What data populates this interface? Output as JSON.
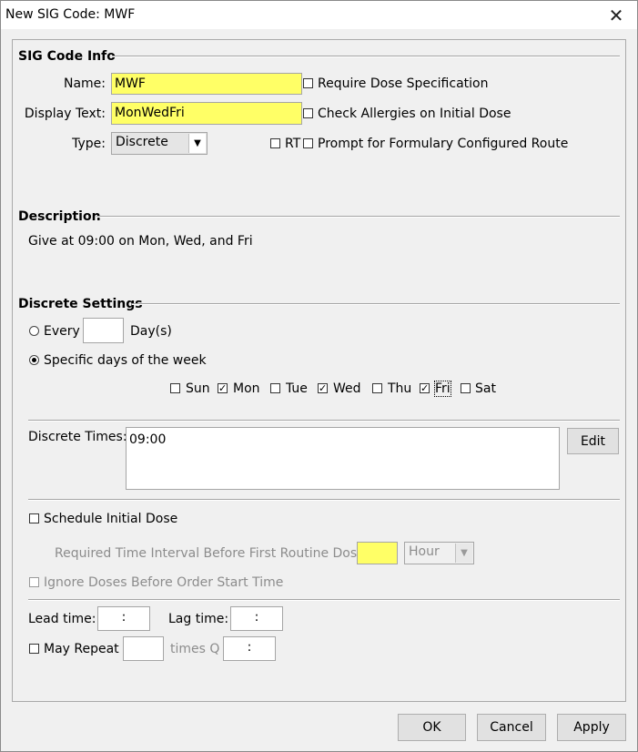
{
  "window": {
    "title": "New SIG Code: MWF",
    "close_glyph": "✕"
  },
  "sig_info": {
    "section_title": "SIG Code Info",
    "name_label": "Name:",
    "name_value": "MWF",
    "display_label": "Display Text:",
    "display_value": "MonWedFri",
    "type_label": "Type:",
    "type_value": "Discrete",
    "require_dose_label": "Require Dose Specification",
    "require_dose_checked": false,
    "check_allergies_label": "Check Allergies on Initial Dose",
    "check_allergies_checked": false,
    "rt_label": "RT",
    "rt_checked": false,
    "prompt_route_label": "Prompt for Formulary Configured Route",
    "prompt_route_checked": false
  },
  "description": {
    "section_title": "Description",
    "text": "Give at 09:00 on Mon, Wed, and Fri"
  },
  "discrete": {
    "section_title": "Discrete Settings",
    "every_label": "Every",
    "every_value": "",
    "days_label": "Day(s)",
    "specific_label": "Specific days of the week",
    "selected_mode": "specific",
    "days": [
      {
        "label": "Sun",
        "checked": false
      },
      {
        "label": "Mon",
        "checked": true
      },
      {
        "label": "Tue",
        "checked": false
      },
      {
        "label": "Wed",
        "checked": true
      },
      {
        "label": "Thu",
        "checked": false
      },
      {
        "label": "Fri",
        "checked": true
      },
      {
        "label": "Sat",
        "checked": false
      }
    ],
    "times_label": "Discrete Times:",
    "times_value": "09:00",
    "edit_label": "Edit"
  },
  "initial_dose": {
    "schedule_label": "Schedule Initial Dose",
    "schedule_checked": false,
    "interval_label": "Required Time Interval Before First Routine Dose:",
    "interval_value": "",
    "unit_value": "Hour",
    "ignore_label": "Ignore Doses Before Order Start Time",
    "ignore_checked": false
  },
  "timing": {
    "lead_label": "Lead time:",
    "lead_value": ":",
    "lag_label": "Lag time:",
    "lag_value": ":",
    "repeat_label": "May Repeat",
    "repeat_checked": false,
    "repeat_value": "",
    "times_q_label": "times Q",
    "times_q_value": ":"
  },
  "buttons": {
    "ok": "OK",
    "cancel": "Cancel",
    "apply": "Apply"
  },
  "icons": {
    "check_glyph": "✓",
    "dropdown_glyph": "▼"
  }
}
